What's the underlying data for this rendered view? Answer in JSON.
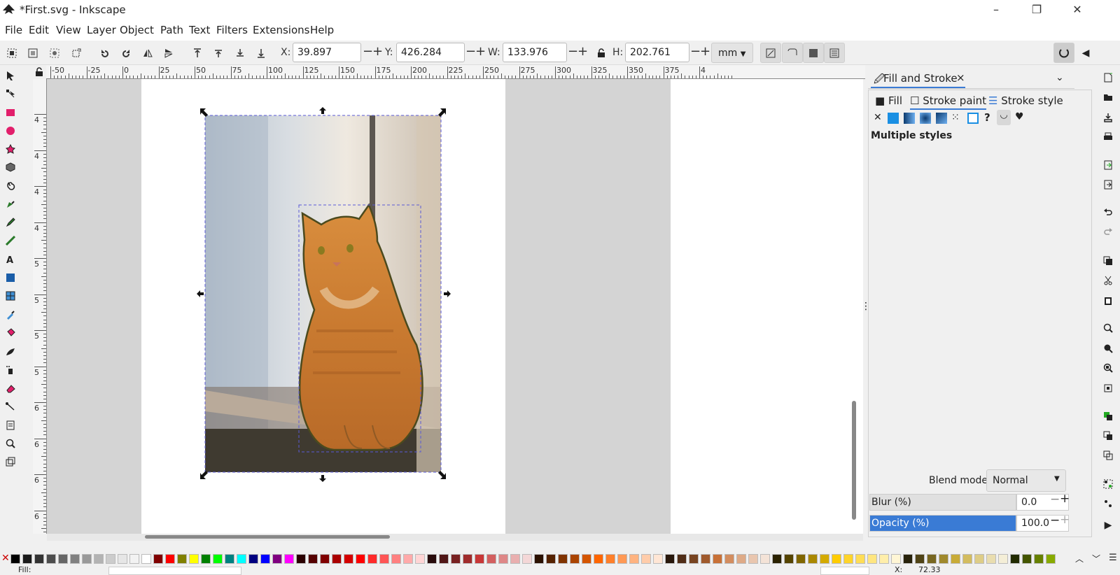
{
  "window": {
    "title": "*First.svg - Inkscape",
    "minimize": "–",
    "restore": "❐",
    "close": "✕"
  },
  "menu": {
    "items": [
      "File",
      "Edit",
      "View",
      "Layer",
      "Object",
      "Path",
      "Text",
      "Filters",
      "Extensions",
      "Help"
    ]
  },
  "toolbar": {
    "x_label": "X:",
    "x_value": "39.897",
    "y_label": "Y:",
    "y_value": "426.284",
    "w_label": "W:",
    "w_value": "133.976",
    "h_label": "H:",
    "h_value": "202.761",
    "unit": "mm"
  },
  "ruler": {
    "h_labels": [
      "-50",
      "-25",
      "0",
      "25",
      "50",
      "75",
      "100",
      "125",
      "150",
      "175",
      "200",
      "225",
      "250",
      "275",
      "300",
      "325",
      "350",
      "375",
      "4"
    ],
    "v_labels": [
      "4",
      "4",
      "4",
      "4",
      "5",
      "5",
      "5",
      "5",
      "6",
      "6",
      "6",
      "6"
    ]
  },
  "dock": {
    "tab_title": "Fill and Stroke",
    "tab_close": "×",
    "subtabs": [
      "Fill",
      "Stroke paint",
      "Stroke style"
    ],
    "paint_note": "Multiple styles",
    "question_mark": "?",
    "blend_label": "Blend mode:",
    "blend_value": "Normal",
    "blur_label": "Blur (%)",
    "blur_value": "0.0",
    "opacity_label": "Opacity (%)",
    "opacity_value": "100.0",
    "opacity_fraction": 1.0,
    "accent": "#3a7bd5"
  },
  "status": {
    "fill_label": "Fill:",
    "x_label": "X:",
    "x_value": "72.33"
  },
  "palette": {
    "colors": [
      "#000000",
      "#1a1a1a",
      "#333333",
      "#4d4d4d",
      "#666666",
      "#808080",
      "#999999",
      "#b3b3b3",
      "#cccccc",
      "#e6e6e6",
      "#f2f2f2",
      "#ffffff",
      "#800000",
      "#ff0000",
      "#808000",
      "#ffff00",
      "#008000",
      "#00ff00",
      "#008080",
      "#00ffff",
      "#000080",
      "#0000ff",
      "#800080",
      "#ff00ff",
      "#2b0000",
      "#550000",
      "#800000",
      "#aa0000",
      "#d40000",
      "#ff0000",
      "#ff2a2a",
      "#ff5555",
      "#ff8080",
      "#ffaaaa",
      "#ffd5d5",
      "#280b0b",
      "#501616",
      "#782121",
      "#a02c2c",
      "#c83737",
      "#d35f5f",
      "#de8787",
      "#e9afaf",
      "#f4d7d7",
      "#2b1100",
      "#552200",
      "#803300",
      "#aa4400",
      "#d45500",
      "#ff6600",
      "#ff7f2a",
      "#ff9955",
      "#ffb380",
      "#ffccaa",
      "#ffe6d5",
      "#28170b",
      "#502d16",
      "#784421",
      "#a05a2c",
      "#c87137",
      "#d38d5f",
      "#deaa87",
      "#e9c6af",
      "#f4e3d7",
      "#2b2200",
      "#554400",
      "#806600",
      "#aa8800",
      "#d4aa00",
      "#ffcc00",
      "#ffd42a",
      "#ffdd55",
      "#ffe680",
      "#ffeeaa",
      "#fff6d5",
      "#28220b",
      "#504416",
      "#786721",
      "#a0892c",
      "#c8ab37",
      "#d3bc5f",
      "#decd87",
      "#e9ddaf",
      "#f4eed7",
      "#222b00",
      "#445500",
      "#668000",
      "#88aa00"
    ]
  },
  "colors": {
    "canvas_bg": "#d4d4d4",
    "page": "#ffffff",
    "selection": "#5a5ad6"
  }
}
